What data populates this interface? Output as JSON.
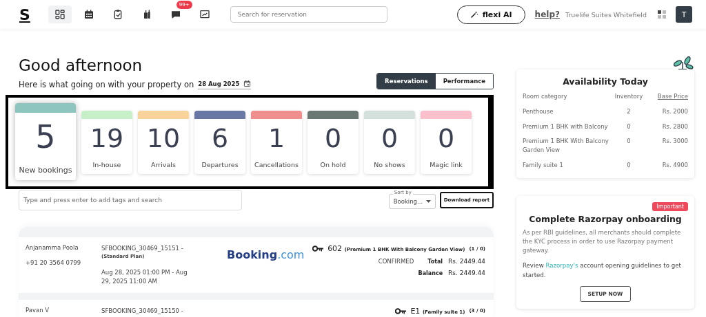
{
  "topbar": {
    "logo": "S",
    "nav": [
      {
        "selected": true
      },
      {
        "selected": false
      },
      {
        "selected": false
      },
      {
        "selected": false
      },
      {
        "selected": false,
        "badge": "99+"
      },
      {
        "selected": false
      }
    ],
    "search": {
      "placeholder": "Search for reservation"
    },
    "ai_button": "flexi AI",
    "help": "help?",
    "property": "Truelife Suites Whitefield",
    "avatar": "T"
  },
  "greeting": "Good afternoon",
  "subtitle": "Here is what going on with your property on",
  "date": "28 Aug 2025",
  "view_tabs": [
    {
      "label": "Reservations",
      "selected": true
    },
    {
      "label": "Performance",
      "selected": false
    }
  ],
  "stats": [
    {
      "value": "5",
      "label": "New bookings",
      "color": "#8fc5bf",
      "selected": true
    },
    {
      "value": "19",
      "label": "In-house",
      "color": "#c8f0c8",
      "selected": false
    },
    {
      "value": "10",
      "label": "Arrivals",
      "color": "#f8d49a",
      "selected": false
    },
    {
      "value": "6",
      "label": "Departures",
      "color": "#6877a3",
      "selected": false
    },
    {
      "value": "1",
      "label": "Cancellations",
      "color": "#f08e8e",
      "selected": false
    },
    {
      "value": "0",
      "label": "On hold",
      "color": "#6a7873",
      "selected": false
    },
    {
      "value": "0",
      "label": "No shows",
      "color": "#d3e0db",
      "selected": false
    },
    {
      "value": "0",
      "label": "Magic link",
      "color": "#fbc0cb",
      "selected": false
    }
  ],
  "tag_search": {
    "placeholder": "Type and press enter to add tags and search"
  },
  "sort": {
    "label": "Sort by",
    "value": "Booking..."
  },
  "download_button": "Download report",
  "reservations": [
    {
      "guest": "Anjanamma Poola",
      "phone": "+91 20 3564 0799",
      "booking_id": "SFBOOKING_30469_15151 -",
      "plan": "(Standard Plan)",
      "dates": "Aug 28, 2025 01:00 PM - Aug 29, 2025 11:00 AM",
      "channel": [
        "Booking",
        ".com"
      ],
      "room": "602",
      "room_type": "(Premium 1 BHK With Balcony Garden View)",
      "occupancy": "(1 / 0)",
      "status": "CONFIRMED",
      "total_label": "Total",
      "total": "Rs. 2449.44",
      "balance_label": "Balance",
      "balance": "Rs. 2449.44"
    },
    {
      "guest": "Pavan V",
      "booking_id": "SFBOOKING_30469_15150 -",
      "room": "E1",
      "room_type": "(Family suite 1)",
      "occupancy": "(3 / 0)"
    }
  ],
  "availability": {
    "title": "Availability Today",
    "columns": [
      "Room category",
      "Inventory",
      "Base Price"
    ],
    "rows": [
      [
        "Penthouse",
        "2",
        "Rs. 2000"
      ],
      [
        "Premium 1 BHK with Balcony",
        "0",
        "Rs. 2800"
      ],
      [
        "Premium 1 BHK With Balcony Garden View",
        "0",
        "Rs. 3000"
      ],
      [
        "Family suite 1",
        "0",
        "Rs. 4900"
      ]
    ]
  },
  "promo": {
    "badge": "Important",
    "title": "Complete Razorpay onboarding",
    "body": "As per RBI guidelines, all merchants should complete the KYC process in order to use Razorpay payment gateway.",
    "review_before": "Review",
    "review_link": "Razorpay's",
    "review_after": "account opening guidelines to get started.",
    "button": "SETUP NOW"
  }
}
